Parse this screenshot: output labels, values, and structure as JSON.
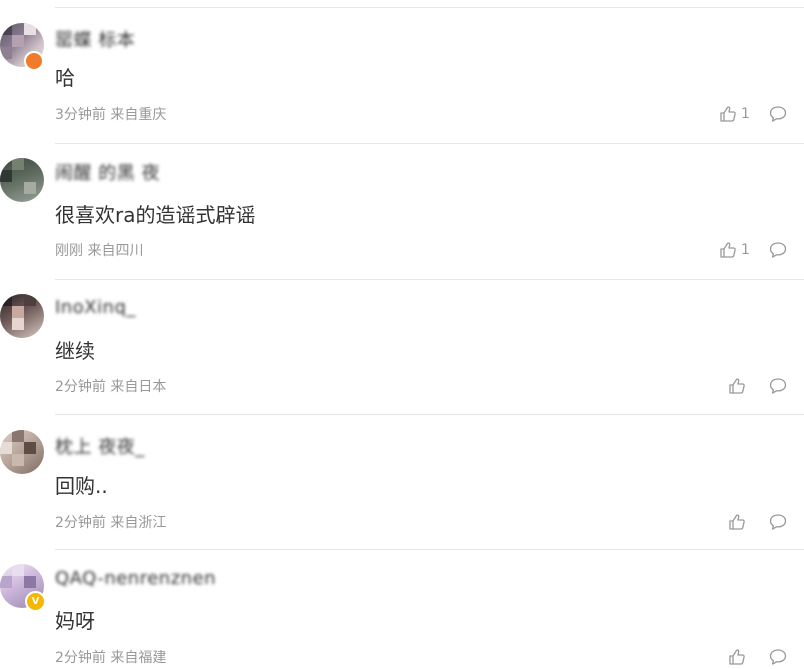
{
  "comments": [
    {
      "username": "罂蝶 标本",
      "text": "哈",
      "meta": "3分钟前 来自重庆",
      "likes": "1",
      "avatar_badge": "orange"
    },
    {
      "username": "闹醒 的黑 夜",
      "text": "很喜欢ra的造谣式辟谣",
      "meta": "刚刚 来自四川",
      "likes": "1",
      "avatar_badge": ""
    },
    {
      "username": "InoXinq_",
      "text": "继续",
      "meta": "2分钟前 来自日本",
      "likes": "",
      "avatar_badge": ""
    },
    {
      "username": "枕上 夜夜_",
      "text": "回购..",
      "meta": "2分钟前 来自浙江",
      "likes": "",
      "avatar_badge": ""
    },
    {
      "username": "QAQ-nenrenznen",
      "text": "妈呀",
      "meta": "2分钟前 来自福建",
      "likes": "",
      "avatar_badge": "V"
    }
  ],
  "icons": {
    "like": "thumbs-up-icon",
    "reply": "speech-bubble-icon"
  },
  "colors": {
    "text_primary": "#333333",
    "text_secondary": "#999999",
    "divider": "#e6e6e6",
    "verified_badge": "#f5b800",
    "orange_badge": "#f07b2b"
  }
}
